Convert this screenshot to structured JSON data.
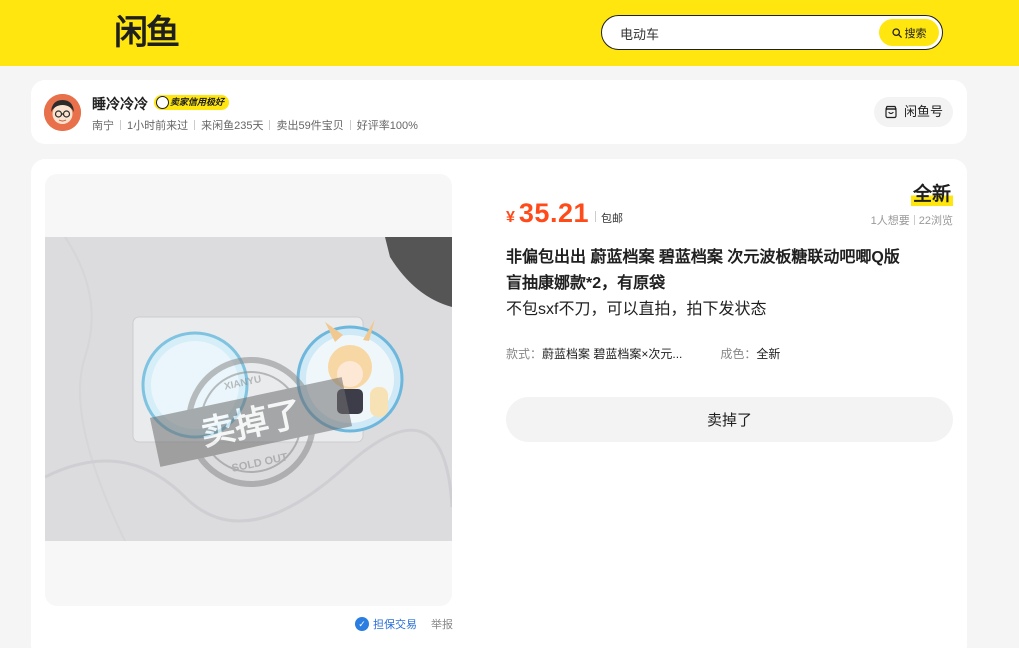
{
  "header": {
    "logo_text": "闲鱼",
    "search_value": "电动车",
    "search_button_label": "搜索",
    "brand_color": "#ffe60f"
  },
  "seller": {
    "name": "睡冷冷冷",
    "credit_badge": "卖家信用极好",
    "meta": [
      "南宁",
      "1小时前来过",
      "来闲鱼235天",
      "卖出59件宝贝",
      "好评率100%"
    ],
    "shop_button_label": "闲鱼号"
  },
  "item": {
    "condition": "全新",
    "price_currency": "¥",
    "price": "35.21",
    "shipping": "包邮",
    "wants": "1人想要",
    "views": "22浏览",
    "description_lines": [
      "非偏包出出 蔚蓝档案 碧蓝档案 次元波板糖联动吧唧Q版",
      "盲抽康娜款*2，有原袋",
      "不包sxf不刀，可以直拍，拍下发状态"
    ],
    "attributes": {
      "style_key": "款式：",
      "style_value": "蔚蓝档案 碧蓝档案×次元...",
      "color_key": "成色：",
      "color_value": "全新"
    },
    "sold_button_label": "卖掉了",
    "price_color": "#ff4a1a",
    "stamp_text": "卖掉了",
    "stamp_sub": "SOLD OUT",
    "stamp_top": "XIANYU"
  },
  "footer": {
    "guarantee_label": "担保交易",
    "report_label": "举报"
  }
}
